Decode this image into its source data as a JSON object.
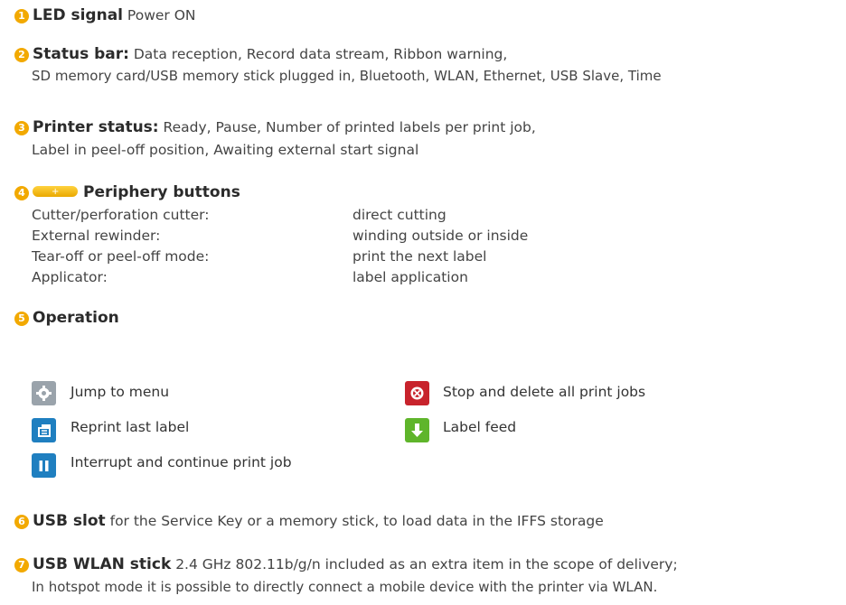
{
  "items": [
    {
      "num": "1",
      "head": "LED signal",
      "text": " Power ON"
    },
    {
      "num": "2",
      "head": "Status bar:",
      "text": " Data reception, Record data stream, Ribbon warning,",
      "line2": "SD memory card/USB memory stick plugged in, Bluetooth, WLAN, Ethernet, USB Slave, Time"
    },
    {
      "num": "3",
      "head": "Printer status:",
      "text": " Ready, Pause, Number of printed labels per print job,",
      "line2": "Label in peel-off position, Awaiting external start signal"
    },
    {
      "num": "4",
      "head": "Periphery buttons"
    },
    {
      "num": "5",
      "head": "Operation"
    },
    {
      "num": "6",
      "head": "USB slot",
      "text": " for the Service Key or a memory stick, to load data in the IFFS storage"
    },
    {
      "num": "7",
      "head": "USB WLAN stick",
      "text": " 2.4 GHz 802.11b/g/n included as an extra item in the scope of delivery;",
      "line2": "In hotspot mode it is possible to directly connect a mobile device with the printer via WLAN."
    }
  ],
  "periphery": [
    {
      "device": "Cutter/perforation cutter:",
      "action": "direct cutting"
    },
    {
      "device": "External rewinder:",
      "action": "winding outside or inside"
    },
    {
      "device": "Tear-off or peel-off mode:",
      "action": "print the next label"
    },
    {
      "device": "Applicator:",
      "action": "label application"
    }
  ],
  "operation": {
    "menu": "Jump to menu",
    "reprint": "Reprint last label",
    "pause": "Interrupt and continue print job",
    "stop": "Stop and delete all print jobs",
    "feed": "Label feed"
  },
  "colors": {
    "accent": "#f2a900",
    "menu_icon": "#9aa3ab",
    "blue_icon": "#1f7fc0",
    "stop_icon": "#c8232c",
    "feed_icon": "#5fb52b"
  },
  "icons": {
    "menu": "gear-icon",
    "reprint": "reprint-icon",
    "pause": "pause-icon",
    "stop": "stop-icon",
    "feed": "down-arrow-icon"
  }
}
